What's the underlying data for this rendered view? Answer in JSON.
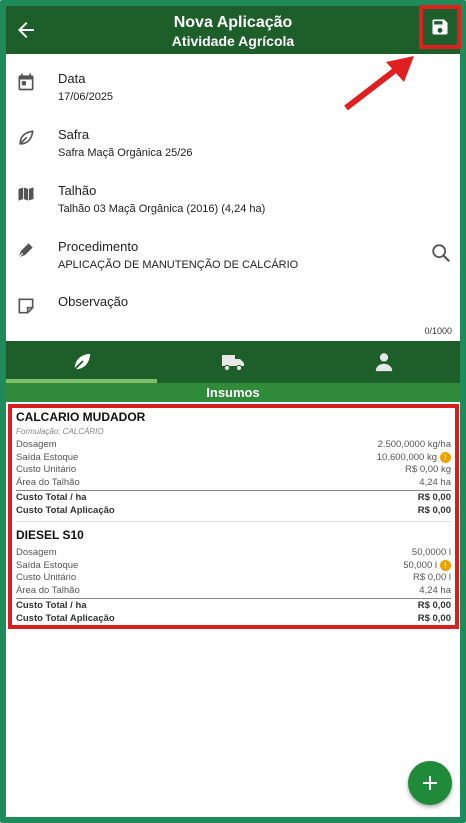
{
  "header": {
    "title": "Nova Aplicação",
    "subtitle": "Atividade Agrícola",
    "back_icon": "arrow-left-icon",
    "save_icon": "floppy-save-icon"
  },
  "form": {
    "data": {
      "label": "Data",
      "value": "17/06/2025"
    },
    "safra": {
      "label": "Safra",
      "value": "Safra Maçã Orgânica 25/26"
    },
    "talhao": {
      "label": "Talhão",
      "value": "Talhão 03 Maçã Orgânica (2016) (4,24 ha)"
    },
    "procedimento": {
      "label": "Procedimento",
      "value": "APLICAÇÃO DE MANUTENÇÃO DE CALCÁRIO"
    },
    "observacao": {
      "label": "Observação",
      "counter": "0/1000"
    }
  },
  "tabs": [
    {
      "icon": "leaf-icon",
      "active": true
    },
    {
      "icon": "truck-icon",
      "active": false
    },
    {
      "icon": "person-icon",
      "active": false
    }
  ],
  "section": {
    "title": "Insumos"
  },
  "insumos": [
    {
      "name": "CALCARIO MUDADOR",
      "formulacao": "Formulação: CALCÁRIO",
      "rows": [
        {
          "k": "Dosagem",
          "v": "2.500,0000 kg/ha"
        },
        {
          "k": "Saída Estoque",
          "v": "10.600,000 kg",
          "warn": true
        },
        {
          "k": "Custo Unitário",
          "v": "R$ 0,00 kg"
        },
        {
          "k": "Área do Talhão",
          "v": "4,24 ha"
        }
      ],
      "totals": [
        {
          "k": "Custo Total / ha",
          "v": "R$ 0,00"
        },
        {
          "k": "Custo Total Aplicação",
          "v": "R$ 0,00"
        }
      ]
    },
    {
      "name": "DIESEL S10",
      "rows": [
        {
          "k": "Dosagem",
          "v": "50,0000 l"
        },
        {
          "k": "Saída Estoque",
          "v": "50,000 l",
          "warn": true
        },
        {
          "k": "Custo Unitário",
          "v": "R$ 0,00 l"
        },
        {
          "k": "Área do Talhão",
          "v": "4,24 ha"
        }
      ],
      "totals": [
        {
          "k": "Custo Total / ha",
          "v": "R$ 0,00"
        },
        {
          "k": "Custo Total Aplicação",
          "v": "R$ 0,00"
        }
      ]
    }
  ],
  "fab": {
    "label": "+"
  },
  "colors": {
    "primary": "#1e5e2b",
    "accent": "#2f8a3a",
    "highlight": "#d81e1e",
    "warning": "#f0a000"
  }
}
